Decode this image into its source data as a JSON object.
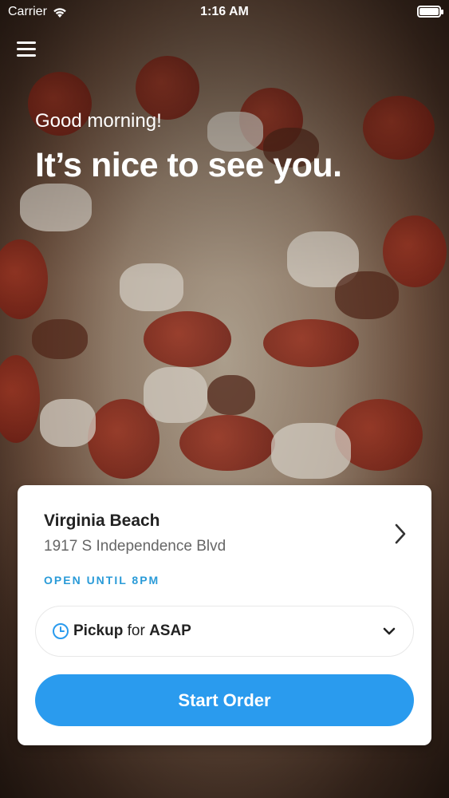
{
  "status_bar": {
    "carrier": "Carrier",
    "time": "1:16 AM"
  },
  "header": {
    "greeting": "Good morning!",
    "headline": "It’s nice to see you."
  },
  "location": {
    "name": "Virginia Beach",
    "address": "1917 S Independence Blvd",
    "status": "OPEN UNTIL 8PM"
  },
  "order_mode": {
    "method": "Pickup",
    "connector": "for",
    "time": "ASAP"
  },
  "actions": {
    "start_label": "Start Order"
  },
  "colors": {
    "accent": "#2a9bee",
    "status_text": "#2a9bd8"
  }
}
